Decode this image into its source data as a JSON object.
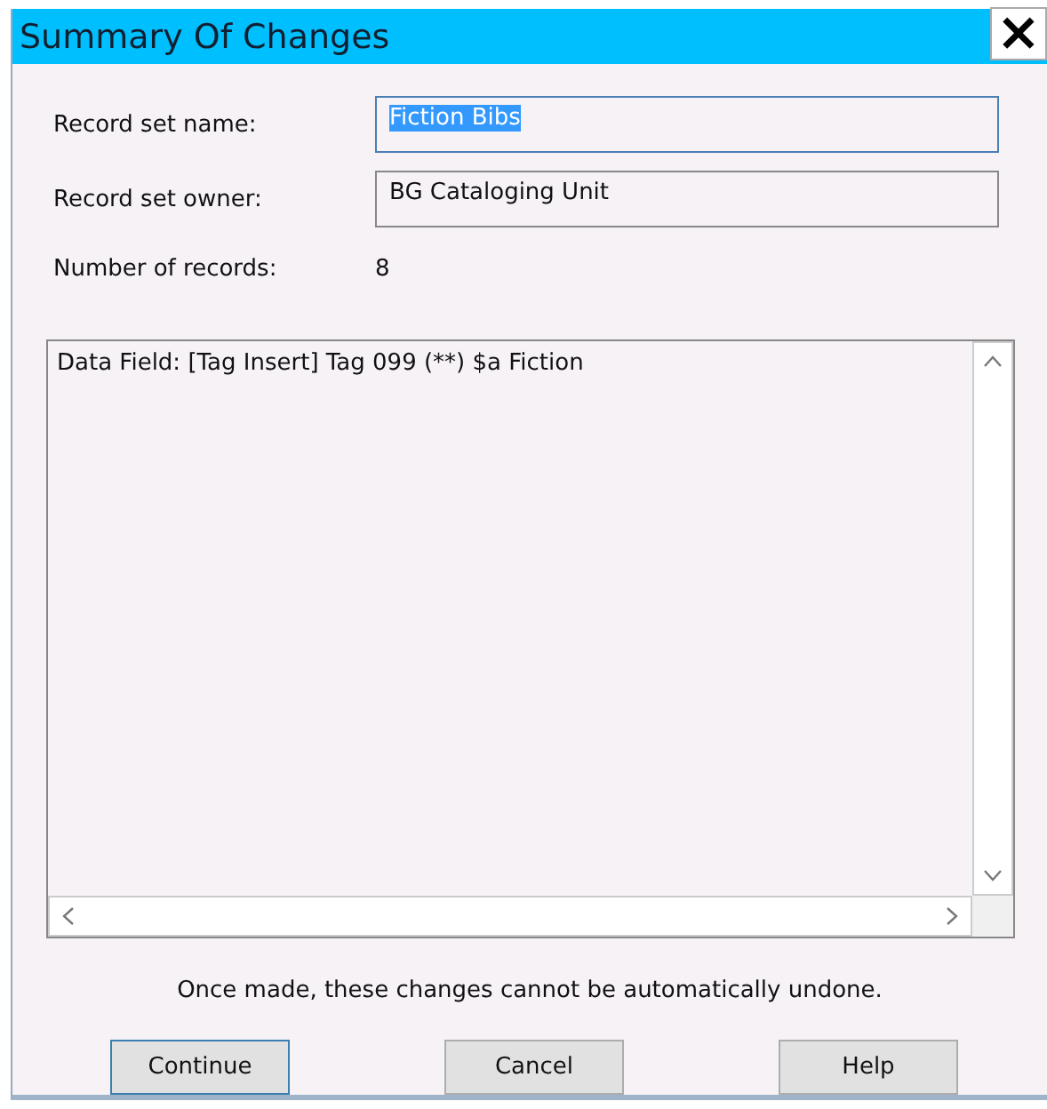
{
  "window": {
    "title": "Summary Of Changes",
    "close": "×"
  },
  "fields": [
    {
      "label": "Record set name:",
      "value": "Fiction Bibs",
      "text_selected": true,
      "focused": true
    },
    {
      "label": "Record set owner:",
      "value": "BG Cataloging Unit",
      "text_selected": false,
      "focused": false
    }
  ],
  "count": {
    "label": "Number of records:",
    "value": "8"
  },
  "changes": [
    "Data Field: [Tag Insert] Tag 099 (**) $a Fiction"
  ],
  "message": "Once made, these changes cannot be automatically undone.",
  "buttons": [
    {
      "label": "Continue",
      "default": true
    },
    {
      "label": "Cancel",
      "default": false
    },
    {
      "label": "Help",
      "default": false
    }
  ]
}
